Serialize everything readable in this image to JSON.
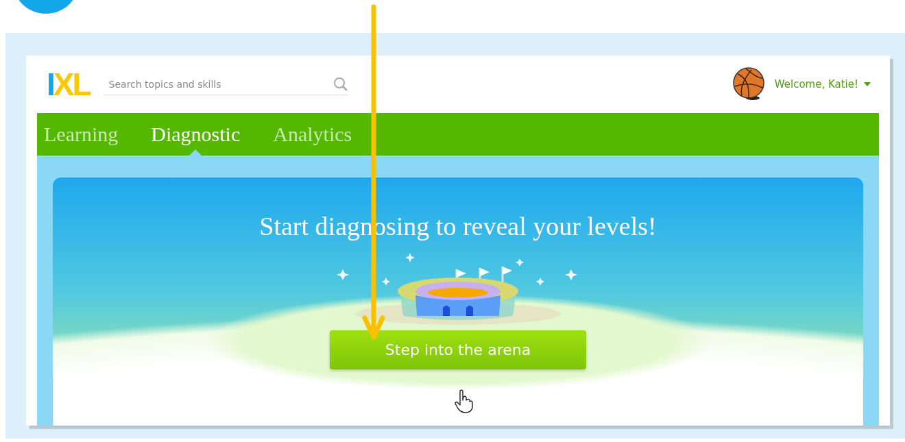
{
  "logo": "IXL",
  "search": {
    "placeholder": "Search topics and skills"
  },
  "user": {
    "greeting": "Welcome, Katie!"
  },
  "tabs": [
    {
      "label": "Learning",
      "selected": false
    },
    {
      "label": "Diagnostic",
      "selected": true
    },
    {
      "label": "Analytics",
      "selected": false
    }
  ],
  "hero": {
    "title": "Start diagnosing to reveal your levels!",
    "button": "Step into the arena"
  }
}
